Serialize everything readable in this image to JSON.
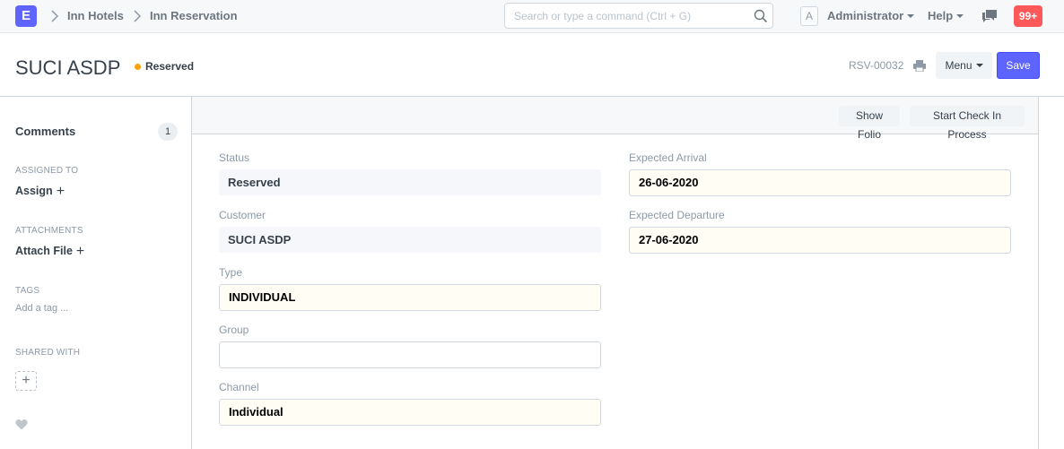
{
  "navbar": {
    "logo": "E",
    "breadcrumbs": [
      "Inn Hotels",
      "Inn Reservation"
    ],
    "search_placeholder": "Search or type a command (Ctrl + G)",
    "avatar_letter": "A",
    "user": "Administrator",
    "help": "Help",
    "notifications": "99+"
  },
  "page": {
    "title": "SUCI ASDP",
    "status": "Reserved",
    "doc_id": "RSV-00032",
    "menu_label": "Menu",
    "save_label": "Save"
  },
  "sidebar": {
    "comments_label": "Comments",
    "comments_count": "1",
    "assigned_to_label": "ASSIGNED TO",
    "assign_label": "Assign",
    "attachments_label": "ATTACHMENTS",
    "attach_label": "Attach File",
    "tags_label": "TAGS",
    "add_tag": "Add a tag ...",
    "shared_with_label": "SHARED WITH"
  },
  "toolbar": {
    "show_folio": "Show Folio",
    "start_check_in": "Start Check In Process"
  },
  "form": {
    "status_label": "Status",
    "status_value": "Reserved",
    "customer_label": "Customer",
    "customer_value": "SUCI ASDP",
    "type_label": "Type",
    "type_value": "INDIVIDUAL",
    "group_label": "Group",
    "group_value": "",
    "channel_label": "Channel",
    "channel_value": "Individual",
    "arrival_label": "Expected Arrival",
    "arrival_value": "26-06-2020",
    "departure_label": "Expected Departure",
    "departure_value": "27-06-2020"
  },
  "colors": {
    "accent": "#5e64ff",
    "status_dot": "#ffa00a",
    "notification": "#ff5858"
  },
  "icons": [
    "search-icon",
    "print-icon",
    "chat-icon",
    "heart-icon",
    "chevron-right-icon",
    "plus-icon"
  ]
}
